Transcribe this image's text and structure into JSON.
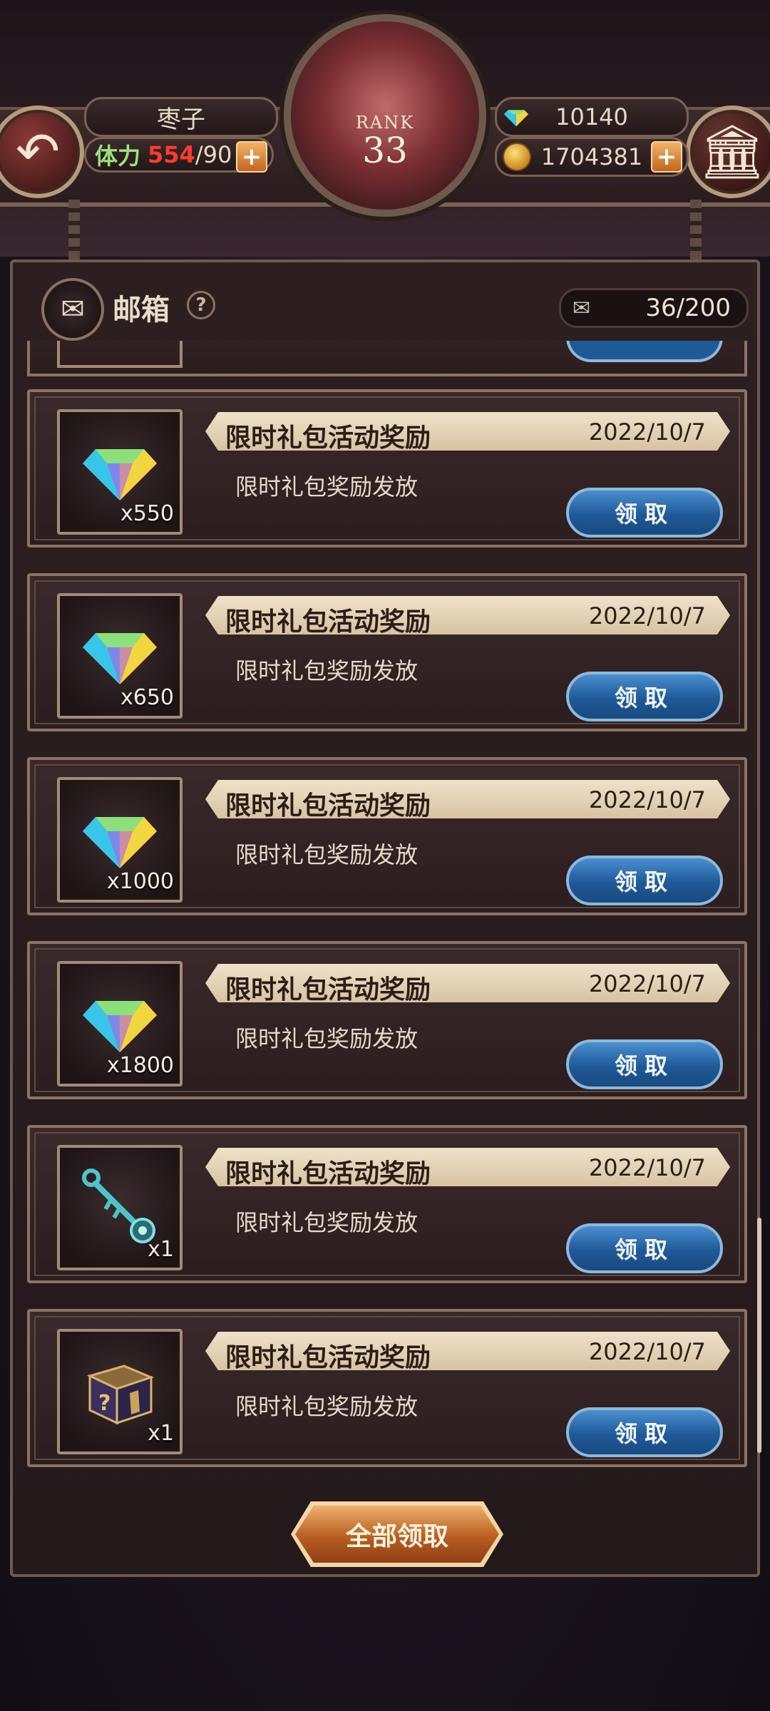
{
  "header": {
    "player_name": "枣子",
    "stamina": {
      "label": "体力",
      "current": "554",
      "separator": "/",
      "max": "90"
    },
    "gems": "10140",
    "gold": "1704381",
    "rank": {
      "label": "RANK",
      "value": "33"
    }
  },
  "mailbox": {
    "title": "邮箱",
    "help_symbol": "?",
    "count": "36/200",
    "claim_all_label": "全部领取",
    "items": [
      {
        "title": "限时礼包活动奖励",
        "date": "2022/10/7",
        "desc": "限时礼包奖励发放",
        "qty": "x550",
        "item_icon": "rainbow-gem-icon",
        "claim_label": "领取"
      },
      {
        "title": "限时礼包活动奖励",
        "date": "2022/10/7",
        "desc": "限时礼包奖励发放",
        "qty": "x650",
        "item_icon": "rainbow-gem-icon",
        "claim_label": "领取"
      },
      {
        "title": "限时礼包活动奖励",
        "date": "2022/10/7",
        "desc": "限时礼包奖励发放",
        "qty": "x1000",
        "item_icon": "rainbow-gem-icon",
        "claim_label": "领取"
      },
      {
        "title": "限时礼包活动奖励",
        "date": "2022/10/7",
        "desc": "限时礼包奖励发放",
        "qty": "x1800",
        "item_icon": "rainbow-gem-icon",
        "claim_label": "领取"
      },
      {
        "title": "限时礼包活动奖励",
        "date": "2022/10/7",
        "desc": "限时礼包奖励发放",
        "qty": "x1",
        "item_icon": "key-icon",
        "claim_label": "领取"
      },
      {
        "title": "限时礼包活动奖励",
        "date": "2022/10/7",
        "desc": "限时礼包奖励发放",
        "qty": "x1",
        "item_icon": "mystery-box-icon",
        "claim_label": "领取"
      }
    ]
  },
  "icons": {
    "back": "back-arrow-icon",
    "menu": "temple-icon",
    "mail": "envelope-icon",
    "gem": "rainbow-gem-icon",
    "gold": "gold-coin-icon",
    "add": "plus-icon"
  }
}
